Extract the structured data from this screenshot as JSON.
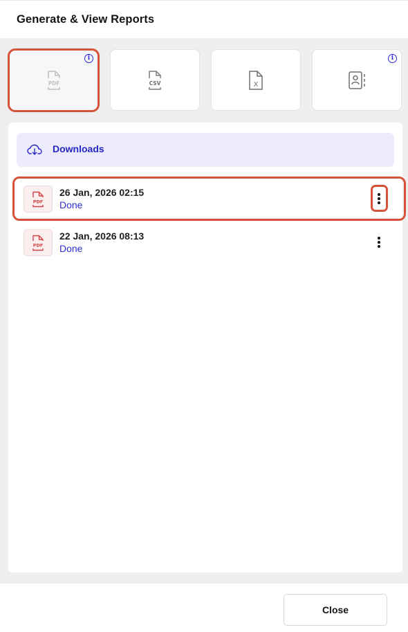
{
  "header": {
    "title": "Generate & View Reports"
  },
  "report_types": [
    {
      "icon": "pdf-file-icon",
      "label": "PDF",
      "selected": true,
      "info": true
    },
    {
      "icon": "csv-file-icon",
      "label": "CSV",
      "selected": false,
      "info": false
    },
    {
      "icon": "excel-file-icon",
      "label": "X",
      "selected": false,
      "info": false
    },
    {
      "icon": "contact-card-icon",
      "label": "",
      "selected": false,
      "info": true
    }
  ],
  "info_glyph": "i",
  "downloads": {
    "icon": "cloud-download-icon",
    "label": "Downloads",
    "items": [
      {
        "icon": "pdf-file-icon",
        "thumb_label": "PDF",
        "date": "26 Jan, 2026 02:15",
        "status": "Done"
      },
      {
        "icon": "pdf-file-icon",
        "thumb_label": "PDF",
        "date": "22 Jan, 2026 08:13",
        "status": "Done"
      }
    ]
  },
  "footer": {
    "close_label": "Close"
  },
  "colors": {
    "accent": "#2626c9",
    "highlight": "#d5533a",
    "pdf_red": "#d04545",
    "downloads_bg": "#ececfd"
  }
}
